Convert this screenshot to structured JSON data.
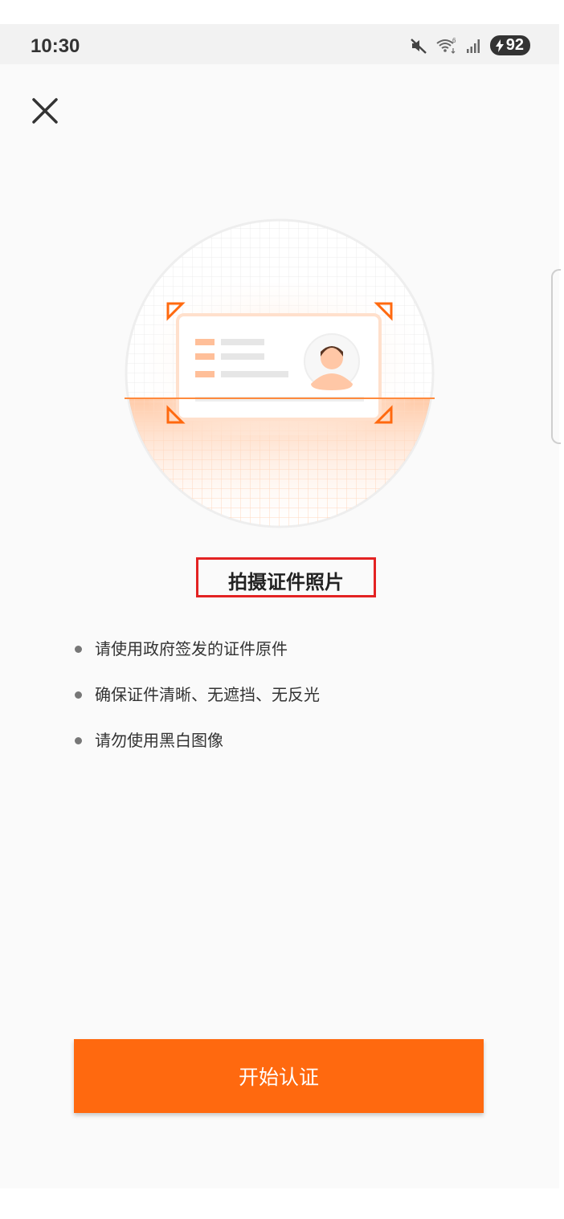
{
  "status_bar": {
    "time": "10:30",
    "battery": "92",
    "icons": [
      "mute-icon",
      "wifi-icon",
      "signal-icon",
      "charging-icon"
    ]
  },
  "header": {
    "close_icon": "close-icon"
  },
  "illustration": {
    "description_icons": [
      "id-card-icon",
      "avatar-icon",
      "scan-corner-icon"
    ],
    "accent_color": "#ff690f"
  },
  "main": {
    "title": "拍摄证件照片",
    "tips": [
      "请使用政府签发的证件原件",
      "确保证件清晰、无遮挡、无反光",
      "请勿使用黑白图像"
    ]
  },
  "footer": {
    "start_button_label": "开始认证",
    "button_color": "#ff690f"
  }
}
